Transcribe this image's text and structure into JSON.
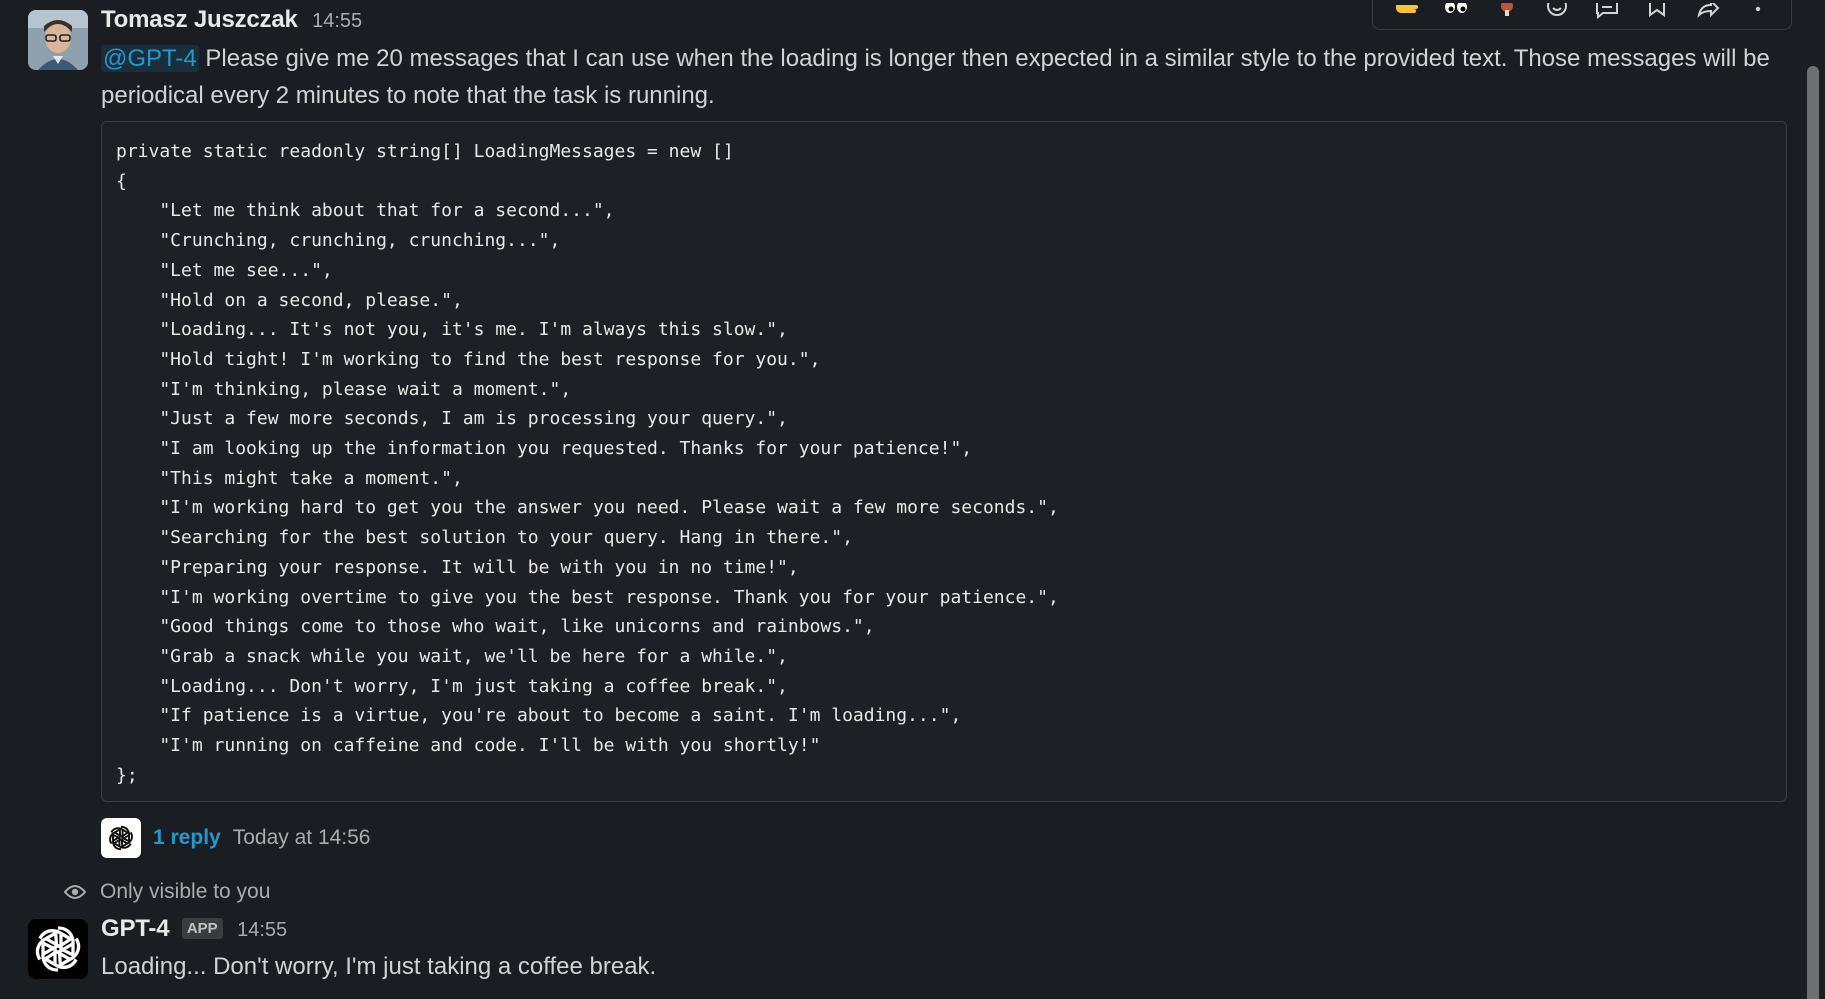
{
  "message_1": {
    "author": "Tomasz Juszczak",
    "time": "14:55",
    "mention": "@GPT-4",
    "text": " Please give me 20 messages that I can use when the loading is longer then expected in a similar style to the provided text. Those messages will be periodical every 2 minutes to note that the task is running.",
    "code_lines": [
      "private static readonly string[] LoadingMessages = new []",
      "{",
      "    \"Let me think about that for a second...\",",
      "    \"Crunching, crunching, crunching...\",",
      "    \"Let me see...\",",
      "    \"Hold on a second, please.\",",
      "    \"Loading... It's not you, it's me. I'm always this slow.\",",
      "    \"Hold tight! I'm working to find the best response for you.\",",
      "    \"I'm thinking, please wait a moment.\",",
      "    \"Just a few more seconds, I am is processing your query.\",",
      "    \"I am looking up the information you requested. Thanks for your patience!\",",
      "    \"This might take a moment.\",",
      "    \"I'm working hard to get you the answer you need. Please wait a few more seconds.\",",
      "    \"Searching for the best solution to your query. Hang in there.\",",
      "    \"Preparing your response. It will be with you in no time!\",",
      "    \"I'm working overtime to give you the best response. Thank you for your patience.\",",
      "    \"Good things come to those who wait, like unicorns and rainbows.\",",
      "    \"Grab a snack while you wait, we'll be here for a while.\",",
      "    \"Loading... Don't worry, I'm just taking a coffee break.\",",
      "    \"If patience is a virtue, you're about to become a saint. I'm loading...\",",
      "    \"I'm running on caffeine and code. I'll be with you shortly!\"",
      "};"
    ],
    "reply_count": "1 reply",
    "reply_time": "Today at 14:56"
  },
  "ephemeral_note": "Only visible to you",
  "message_2": {
    "author": "GPT-4",
    "badge": "APP",
    "time": "14:55",
    "text": "Loading... Don't worry, I'm just taking a coffee break."
  },
  "toolbar_icons": [
    "thumbs-up-emoji-icon",
    "eyes-emoji-icon",
    "drumstick-emoji-icon",
    "add-reaction-icon",
    "reply-in-thread-icon",
    "bookmark-icon",
    "share-icon",
    "more-actions-icon"
  ],
  "colors": {
    "background": "#1a1d21",
    "link": "#1d9bd1",
    "text": "#d1d2d3",
    "muted": "#ababad"
  }
}
